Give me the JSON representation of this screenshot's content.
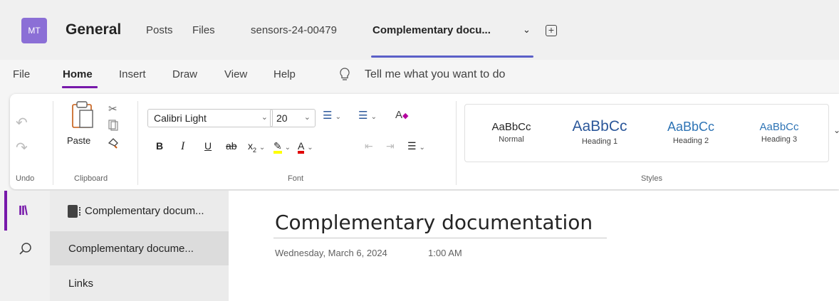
{
  "header": {
    "avatar_initials": "MT",
    "channel": "General",
    "tabs": [
      {
        "label": "Posts"
      },
      {
        "label": "Files"
      },
      {
        "label": "sensors-24-00479"
      },
      {
        "label": "Complementary docu..."
      }
    ]
  },
  "ribbon_tabs": [
    "File",
    "Home",
    "Insert",
    "Draw",
    "View",
    "Help"
  ],
  "tell_me": "Tell me what you want to do",
  "ribbon": {
    "undo_group": "Undo",
    "clipboard": {
      "paste": "Paste",
      "group": "Clipboard"
    },
    "font": {
      "family": "Calibri Light",
      "size": "20",
      "group": "Font",
      "bold": "B",
      "italic": "I",
      "underline": "U",
      "strike": "ab",
      "subscript": "x",
      "subscript_2": "2",
      "font_color": "A"
    },
    "styles": {
      "group": "Styles",
      "items": [
        {
          "sample": "AaBbCc",
          "name": "Normal"
        },
        {
          "sample": "AaBbCc",
          "name": "Heading 1"
        },
        {
          "sample": "AaBbCc",
          "name": "Heading 2"
        },
        {
          "sample": "AaBbCc",
          "name": "Heading 3"
        }
      ]
    }
  },
  "notebook": {
    "title": "Complementary docum...",
    "sections": [
      {
        "label": "Complementary docume...",
        "active": true
      },
      {
        "label": "Links",
        "active": false
      }
    ]
  },
  "page": {
    "title": "Complementary documentation",
    "date": "Wednesday, March 6, 2024",
    "time": "1:00 AM"
  },
  "colors": {
    "accent_teams": "#5b5fc7",
    "accent_onenote": "#7719aa",
    "highlight": "#ffff00",
    "font_color_bar": "#e00000",
    "heading_blue": "#2b579a"
  },
  "icons": [
    "undo-icon",
    "redo-icon",
    "paste-icon",
    "cut-icon",
    "copy-icon",
    "format-painter-icon",
    "bullets-icon",
    "numbering-icon",
    "clear-formatting-icon",
    "highlighter-icon",
    "font-color-icon",
    "outdent-icon",
    "indent-icon",
    "align-icon",
    "lightbulb-icon",
    "library-icon",
    "search-icon",
    "notebook-icon",
    "add-tab-icon",
    "chevron-down-icon"
  ]
}
